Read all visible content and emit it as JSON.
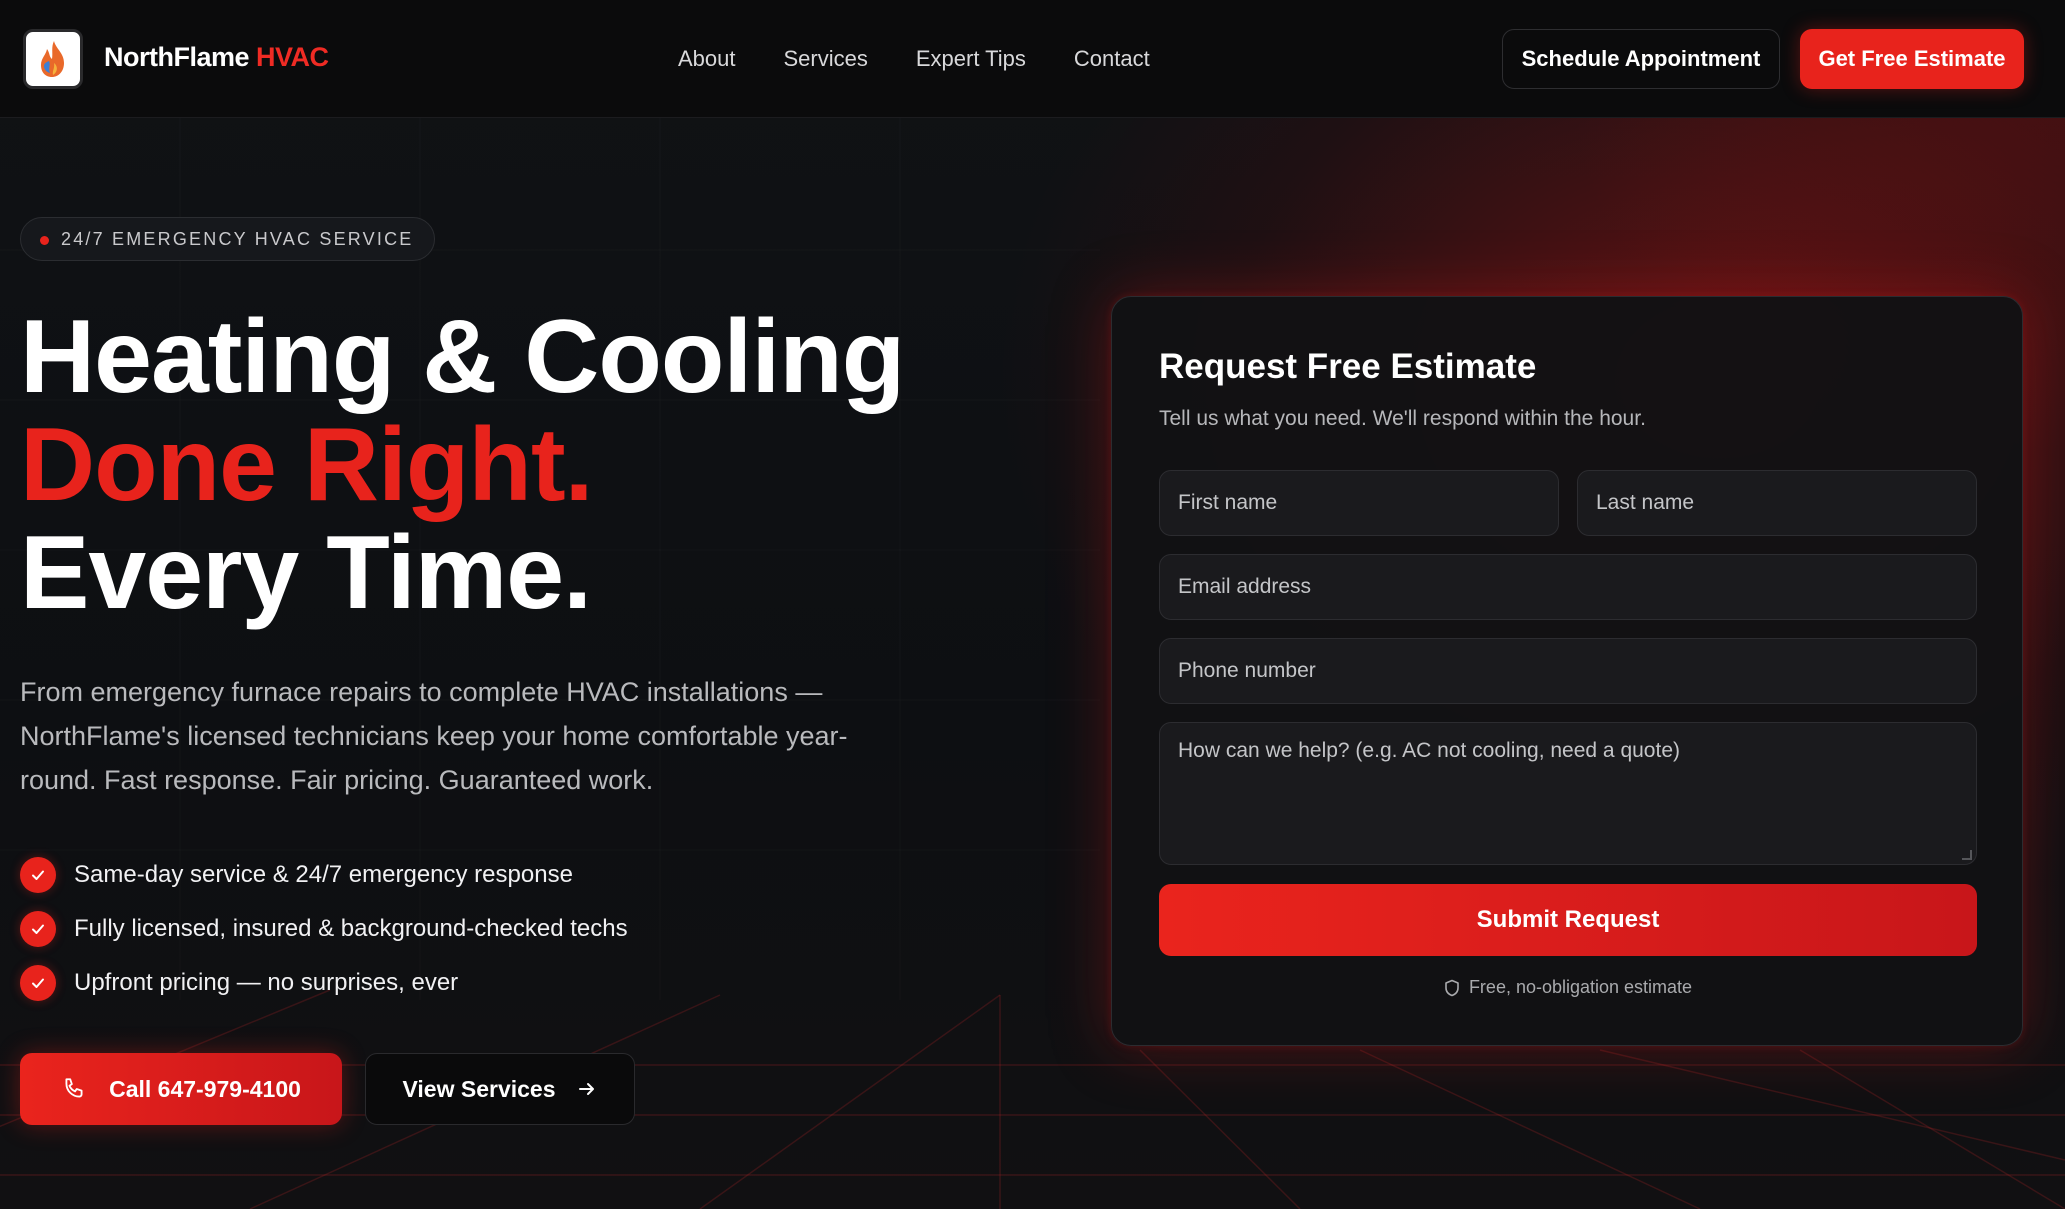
{
  "header": {
    "brand_name": "NorthFlame",
    "brand_accent": "HVAC",
    "nav": [
      "About",
      "Services",
      "Expert Tips",
      "Contact"
    ],
    "schedule_label": "Schedule Appointment",
    "estimate_label": "Get Free Estimate"
  },
  "hero": {
    "badge": "24/7 EMERGENCY HVAC SERVICE",
    "headline_line1": "Heating & Cooling",
    "headline_line2": "Done Right.",
    "headline_line3": "Every Time.",
    "description": "From emergency furnace repairs to complete HVAC installations — NorthFlame's licensed technicians keep your home comfortable year-round. Fast response. Fair pricing. Guaranteed work.",
    "bullets": [
      "Same-day service & 24/7 emergency response",
      "Fully licensed, insured & background-checked techs",
      "Upfront pricing — no surprises, ever"
    ],
    "call_label": "Call 647-979-4100",
    "services_label": "View Services"
  },
  "form": {
    "title": "Request Free Estimate",
    "subtitle": "Tell us what you need. We'll respond within the hour.",
    "first_name_placeholder": "First name",
    "last_name_placeholder": "Last name",
    "email_placeholder": "Email address",
    "phone_placeholder": "Phone number",
    "message_placeholder": "How can we help? (e.g. AC not cooling, need a quote)",
    "submit_label": "Submit Request",
    "note": "Free, no-obligation estimate"
  },
  "colors": {
    "accent": "#e8231c",
    "background": "#0c0d0f",
    "card": "#121214"
  },
  "icons": [
    "flame-logo-icon",
    "check-icon",
    "phone-icon",
    "arrow-right-icon",
    "shield-icon"
  ]
}
